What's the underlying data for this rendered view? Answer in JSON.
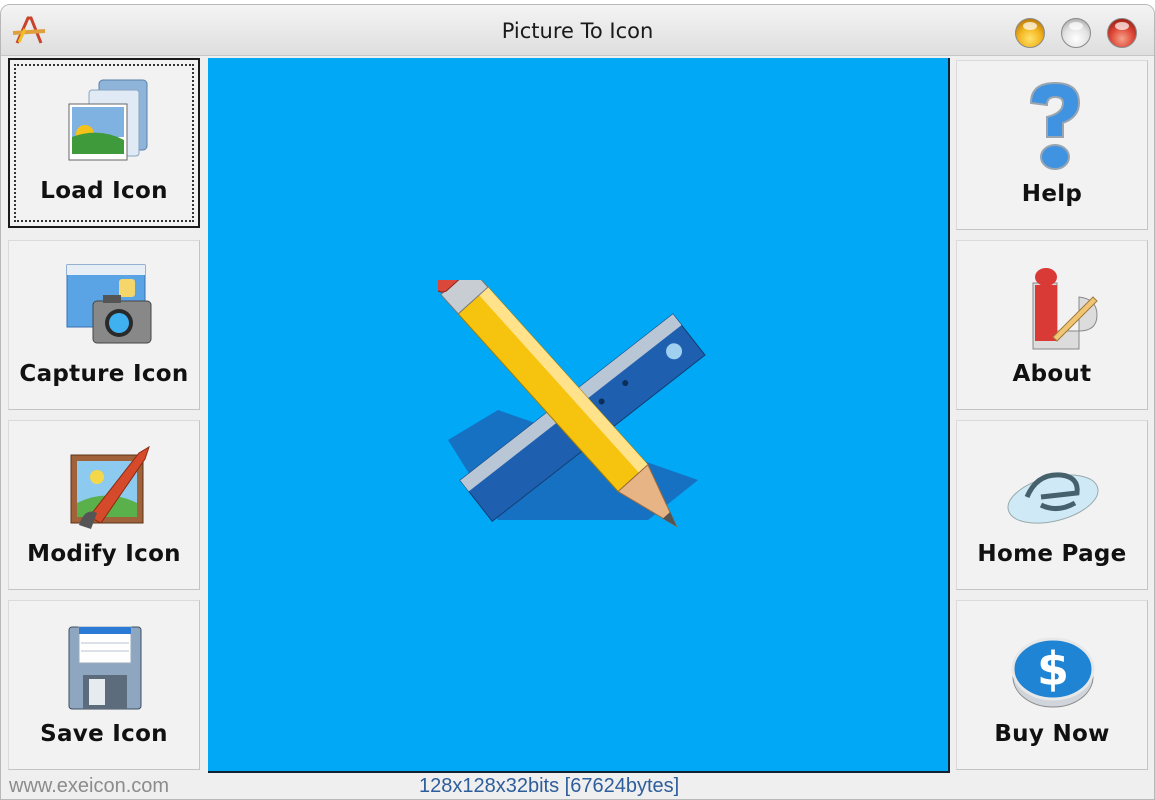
{
  "window": {
    "title": "Picture To Icon",
    "controls": [
      "minimize",
      "zoom",
      "close"
    ]
  },
  "left_toolbar": [
    {
      "id": "load",
      "label": "Load Icon",
      "icon": "load-pictures-icon",
      "focused": true
    },
    {
      "id": "capture",
      "label": "Capture Icon",
      "icon": "camera-icon",
      "focused": false
    },
    {
      "id": "modify",
      "label": "Modify Icon",
      "icon": "paintbrush-picture-icon",
      "focused": false
    },
    {
      "id": "save",
      "label": "Save Icon",
      "icon": "floppy-disk-icon",
      "focused": false
    }
  ],
  "right_toolbar": [
    {
      "id": "help",
      "label": "Help",
      "icon": "question-mark-icon"
    },
    {
      "id": "about",
      "label": "About",
      "icon": "info-pencil-icon"
    },
    {
      "id": "homepage",
      "label": "Home Page",
      "icon": "internet-explorer-icon"
    },
    {
      "id": "buy",
      "label": "Buy Now",
      "icon": "dollar-coin-icon"
    }
  ],
  "preview": {
    "background_color": "#00a8f6",
    "image": "pencil-and-ruler-icon"
  },
  "status": {
    "website": "www.exeicon.com",
    "image_info": "128x128x32bits  [67624bytes]"
  }
}
